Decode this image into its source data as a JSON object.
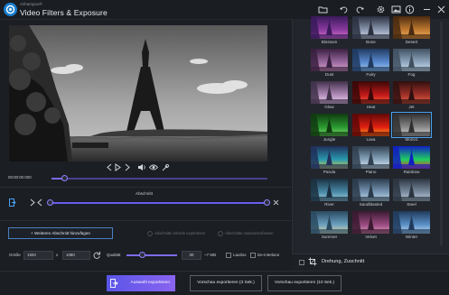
{
  "app": {
    "brand": "Ashampoo®",
    "title": "Video Filters & Exposure"
  },
  "toolbar": {
    "icons": [
      "folder-icon",
      "undo-icon",
      "redo-icon",
      "gear-icon",
      "image-icon",
      "info-icon",
      "minimize-icon",
      "close-icon"
    ]
  },
  "player": {
    "timecode": "00:00:00.000",
    "position_fraction": 0.05
  },
  "section": {
    "label": "Abschnitt",
    "add_button": "+ Weiteren Abschnitt hinzufügen",
    "export_separately": "Abschnitte einzeln exportieren",
    "merge": "Abschnitte zusammenfassen"
  },
  "settings": {
    "size_label": "Größe",
    "width": "1920",
    "x": "x",
    "height": "1080",
    "quality_label": "Qualität",
    "quality_value": "30",
    "size_estimate": "~7 MB",
    "lautlos": "Lautlos",
    "deinterlace": "De-interlace"
  },
  "filters": [
    {
      "label": "Blossom",
      "colors": [
        "#3a1a5a",
        "#8a3aa0",
        "#e07ad0"
      ]
    },
    {
      "label": "Bone",
      "colors": [
        "#2a3040",
        "#8a98b0",
        "#d8dde6"
      ]
    },
    {
      "label": "Desert",
      "colors": [
        "#4a2a10",
        "#c07a30",
        "#f0b060"
      ]
    },
    {
      "label": "Dust",
      "colors": [
        "#3a2040",
        "#9a6aa0",
        "#e0a8c8"
      ]
    },
    {
      "label": "Fairy",
      "colors": [
        "#203a60",
        "#5a8ad0",
        "#a8d0f0"
      ]
    },
    {
      "label": "Fog",
      "colors": [
        "#405060",
        "#90a8c0",
        "#d0e0ec"
      ]
    },
    {
      "label": "Glow",
      "colors": [
        "#40304a",
        "#b08ab8",
        "#f0d8f0"
      ]
    },
    {
      "label": "Heat",
      "colors": [
        "#3a0808",
        "#c01818",
        "#ff6040"
      ]
    },
    {
      "label": "Jet",
      "colors": [
        "#301010",
        "#a03028",
        "#e06848"
      ]
    },
    {
      "label": "Jungle",
      "colors": [
        "#103a10",
        "#2a9a30",
        "#80e070"
      ]
    },
    {
      "label": "Lava",
      "colors": [
        "#600808",
        "#e02010",
        "#ffb020"
      ]
    },
    {
      "label": "Mono1",
      "colors": [
        "#303030",
        "#8a8a8a",
        "#d8d8d8"
      ]
    },
    {
      "label": "Parula",
      "colors": [
        "#20305a",
        "#2a9ab0",
        "#e0d040"
      ]
    },
    {
      "label": "Piano",
      "colors": [
        "#304050",
        "#8aa8c0",
        "#e8eef2"
      ]
    },
    {
      "label": "Rainbow",
      "colors": [
        "#1020c0",
        "#20d060",
        "#ff3020"
      ]
    },
    {
      "label": "River",
      "colors": [
        "#1a3040",
        "#4a8aa8",
        "#a8d8e8"
      ]
    },
    {
      "label": "Sandblasted",
      "colors": [
        "#2a3a4a",
        "#7a9ab8",
        "#c8dce8"
      ]
    },
    {
      "label": "Steel",
      "colors": [
        "#2a3440",
        "#7a8ca0",
        "#c8d4e0"
      ]
    },
    {
      "label": "Summer",
      "colors": [
        "#2a4a60",
        "#6aa0c0",
        "#e8d8a0"
      ]
    },
    {
      "label": "Velvet",
      "colors": [
        "#3a1a30",
        "#9a4a80",
        "#e0a0c0"
      ]
    },
    {
      "label": "Winter",
      "colors": [
        "#203a5a",
        "#5a90c8",
        "#c8e0f4"
      ]
    }
  ],
  "selected_filter": "Mono1",
  "rotation": {
    "label": "Drehung, Zuschnitt"
  },
  "bottom": {
    "export_button": "Auswahl exportieren",
    "preview3": "Vorschau exportieren (3 Sek.)",
    "preview10": "Vorschau exportieren (10 Sek.)"
  }
}
